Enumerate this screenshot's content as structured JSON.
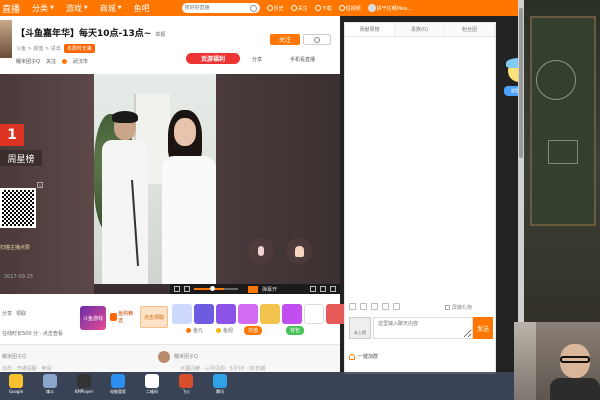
{
  "topnav": {
    "brand": "直播",
    "items": [
      {
        "label": "分类",
        "has_arrow": true
      },
      {
        "label": "游戏",
        "has_arrow": true
      },
      {
        "label": "商城",
        "has_arrow": true
      },
      {
        "label": "鱼吧",
        "has_arrow": false
      }
    ],
    "search_placeholder": "搜好好直播",
    "tools": [
      "历史",
      "关注",
      "下载",
      "短视频"
    ],
    "username": "拼干往哪Mea..."
  },
  "room": {
    "title": "【斗鱼嘉年华】每天10点-13点~",
    "report": "举报",
    "category_path": "斗鱼 > 颜值 > 进出",
    "rank_badge": "本周时长第",
    "owner": "糯米团子Q",
    "follower_hint": "关注",
    "location": "武汉市",
    "follow_label": "关注",
    "promo_label": "页游福利",
    "share_label": "分享",
    "mobile_label": "手机看直播"
  },
  "video": {
    "weekly_rank_number": "1",
    "weekly_rank_label": "周星榜",
    "qr_caption": "扫描主播点赞",
    "timestamp": "2017-09-25",
    "danmu_label": "弹幕开"
  },
  "giftbar": {
    "left_tools": [
      "分享",
      "领取"
    ],
    "online_info": "在线时长500 分 · 点击查看",
    "game_logo_label": "斗鱼游戏",
    "fish_prize_label": "鱼购精选",
    "bamboo_label": "点击领取",
    "gift_sub_left": "鱼丸",
    "gift_sub_mid": "鱼翅",
    "charge_label": "充值",
    "bag_label": "背包",
    "gift_colors": [
      "#cfd9ff",
      "#6d5be0",
      "#8c54e6",
      "#d16cf0",
      "#f1c24c",
      "#c24ef0",
      "#ffffff",
      "#e75a5a"
    ]
  },
  "comments": {
    "anchor_name": "糯米团子Q",
    "commenter_name": "糯米团子Q",
    "line1": "动态 · 开播提醒 · 申请",
    "line2": "大厦闪耀 · 三月见闻 · 5月18 · 30日期"
  },
  "chat": {
    "tabs": [
      "贡献周榜",
      "贵族(0)",
      "粉丝团"
    ],
    "active_tab": 0,
    "block_gift": "屏蔽礼物",
    "input_placeholder": "这里输入聊天内容",
    "level_badge": "未上榜",
    "send_label": "发送",
    "add_group": "一键加群"
  },
  "mascot": {
    "label": "超管推荐"
  },
  "taskbar": {
    "items": [
      {
        "label": "Google",
        "color": "#f6c12c"
      },
      {
        "label": "魂斗",
        "color": "#8aa5c9"
      },
      {
        "label": "KMPlayer",
        "color": "#333333"
      },
      {
        "label": "电脑管家",
        "color": "#2b8ff0"
      },
      {
        "label": "二维码",
        "color": "#ffffff"
      },
      {
        "label": "飞火",
        "color": "#d84f2b"
      },
      {
        "label": "腾讯",
        "color": "#30a3e8"
      }
    ]
  }
}
